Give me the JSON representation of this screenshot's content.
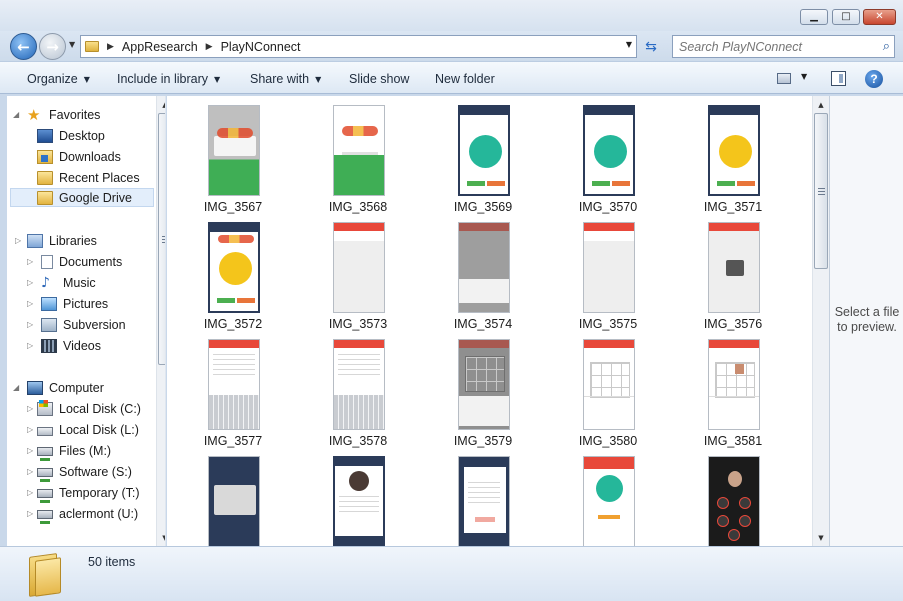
{
  "window": {
    "minimize_glyph": "▁",
    "maximize_glyph": "□",
    "close_glyph": "✕"
  },
  "address": {
    "crumbs": [
      "AppResearch",
      "PlayNConnect"
    ],
    "search_placeholder": "Search PlayNConnect",
    "back_icon": "back-arrow-icon",
    "forward_icon": "forward-arrow-icon",
    "refresh_icon": "refresh-icon",
    "search_icon": "search-icon"
  },
  "toolbar": {
    "organize": "Organize",
    "include_in_library": "Include in library",
    "share_with": "Share with",
    "slide_show": "Slide show",
    "new_folder": "New folder",
    "help": "?"
  },
  "nav": {
    "favorites": {
      "label": "Favorites",
      "items": [
        "Desktop",
        "Downloads",
        "Recent Places",
        "Google Drive"
      ]
    },
    "libraries": {
      "label": "Libraries",
      "items": [
        "Documents",
        "Music",
        "Pictures",
        "Subversion",
        "Videos"
      ]
    },
    "computer": {
      "label": "Computer",
      "items": [
        "Local Disk (C:)",
        "Local Disk (L:)",
        "Files (M:)",
        "Software (S:)",
        "Temporary (T:)",
        "aclermont (U:)"
      ]
    },
    "selected": "Google Drive"
  },
  "files": [
    {
      "name": "IMG_3567",
      "style": "splash-dialog"
    },
    {
      "name": "IMG_3568",
      "style": "splash-green"
    },
    {
      "name": "IMG_3569",
      "style": "teal-disc"
    },
    {
      "name": "IMG_3570",
      "style": "teal-disc"
    },
    {
      "name": "IMG_3571",
      "style": "yellow-disc"
    },
    {
      "name": "IMG_3572",
      "style": "yellow-disc-logo"
    },
    {
      "name": "IMG_3573",
      "style": "blank-list"
    },
    {
      "name": "IMG_3574",
      "style": "grey-menu"
    },
    {
      "name": "IMG_3575",
      "style": "blank-list"
    },
    {
      "name": "IMG_3576",
      "style": "loading"
    },
    {
      "name": "IMG_3577",
      "style": "keyboard"
    },
    {
      "name": "IMG_3578",
      "style": "keyboard"
    },
    {
      "name": "IMG_3579",
      "style": "grey-grid"
    },
    {
      "name": "IMG_3580",
      "style": "grid"
    },
    {
      "name": "IMG_3581",
      "style": "grid-photo"
    },
    {
      "name": "",
      "style": "dark-dialog"
    },
    {
      "name": "",
      "style": "profile"
    },
    {
      "name": "",
      "style": "dark-form"
    },
    {
      "name": "",
      "style": "promo"
    },
    {
      "name": "",
      "style": "dark-avatars"
    }
  ],
  "preview": {
    "message": "Select a file to preview."
  },
  "details": {
    "item_count": "50 items"
  },
  "colors": {
    "selection": "#e3eefb",
    "accent": "#2a6bc4",
    "app_red": "#e8483a",
    "app_teal": "#25b79a",
    "app_navy": "#2b3b59",
    "app_yellow": "#f4c51b",
    "app_green": "#3fae55"
  }
}
